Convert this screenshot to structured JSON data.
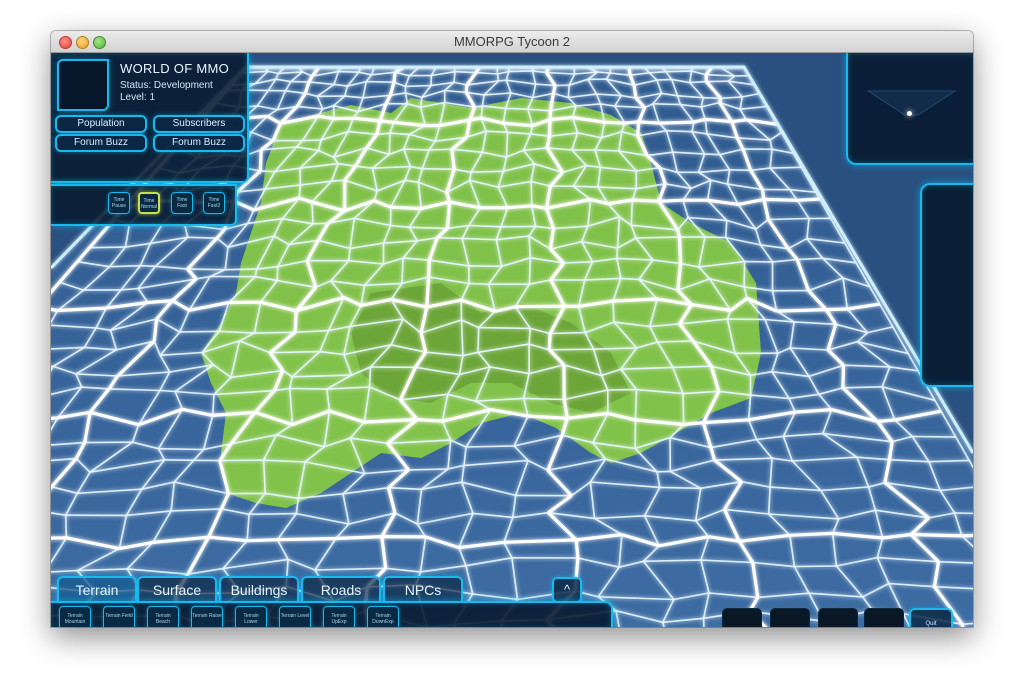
{
  "window": {
    "title": "MMORPG Tycoon 2"
  },
  "info": {
    "world_name": "WORLD OF MMO",
    "status": "Status: Development",
    "level": "Level: 1",
    "buttons": {
      "population": "Population",
      "subscribers": "Subscribers",
      "forum_buzz_1": "Forum Buzz",
      "forum_buzz_2": "Forum Buzz"
    }
  },
  "time_controls": {
    "pause": "Time Pause",
    "normal": "Time Normal",
    "fast": "Time Fast",
    "fast2": "Time Fast2",
    "active": "normal"
  },
  "tabs": [
    "Terrain",
    "Surface",
    "Buildings",
    "Roads",
    "NPCs"
  ],
  "active_tab": "Terrain",
  "expand_label": "^",
  "terrain_tools": [
    "Terrain Mountain",
    "Terrain Field",
    "Terrain Beach",
    "Terrain Raise",
    "Terrain Lower",
    "Terrain Level",
    "Terrain UpExp",
    "Terrain DownExp"
  ],
  "quit_label": "Quit",
  "dev_label": "dev",
  "colors": {
    "ui_glow": "#19b9ee",
    "ocean": "#3c6aa0",
    "land": "#8ed23c",
    "background": "#29507f"
  }
}
